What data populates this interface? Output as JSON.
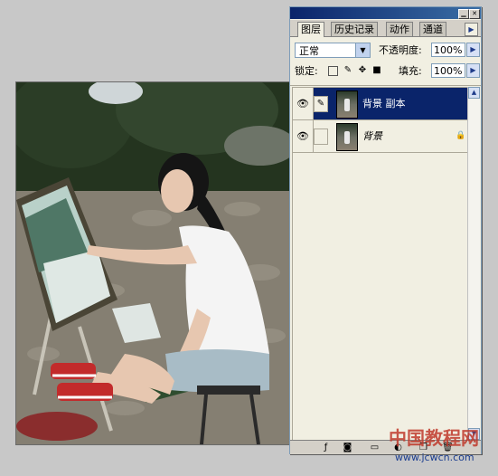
{
  "tabs": [
    {
      "label": "图层",
      "active": true
    },
    {
      "label": "历史记录",
      "active": false
    },
    {
      "label": "动作",
      "active": false
    },
    {
      "label": "通道",
      "active": false
    }
  ],
  "blend_mode": "正常",
  "opacity_label": "不透明度:",
  "opacity_value": "100%",
  "lock_label": "锁定:",
  "fill_label": "填充:",
  "fill_value": "100%",
  "layers": [
    {
      "name": "背景 副本",
      "selected": true,
      "visible": true
    },
    {
      "name": "背景",
      "selected": false,
      "visible": true,
      "locked": true
    }
  ],
  "watermark": {
    "main": "中国教程网",
    "url": "www.jcwcn.com"
  },
  "colors": {
    "selection": "#0a246a",
    "panel": "#f1efe2",
    "titlebar": "#0a246a"
  }
}
